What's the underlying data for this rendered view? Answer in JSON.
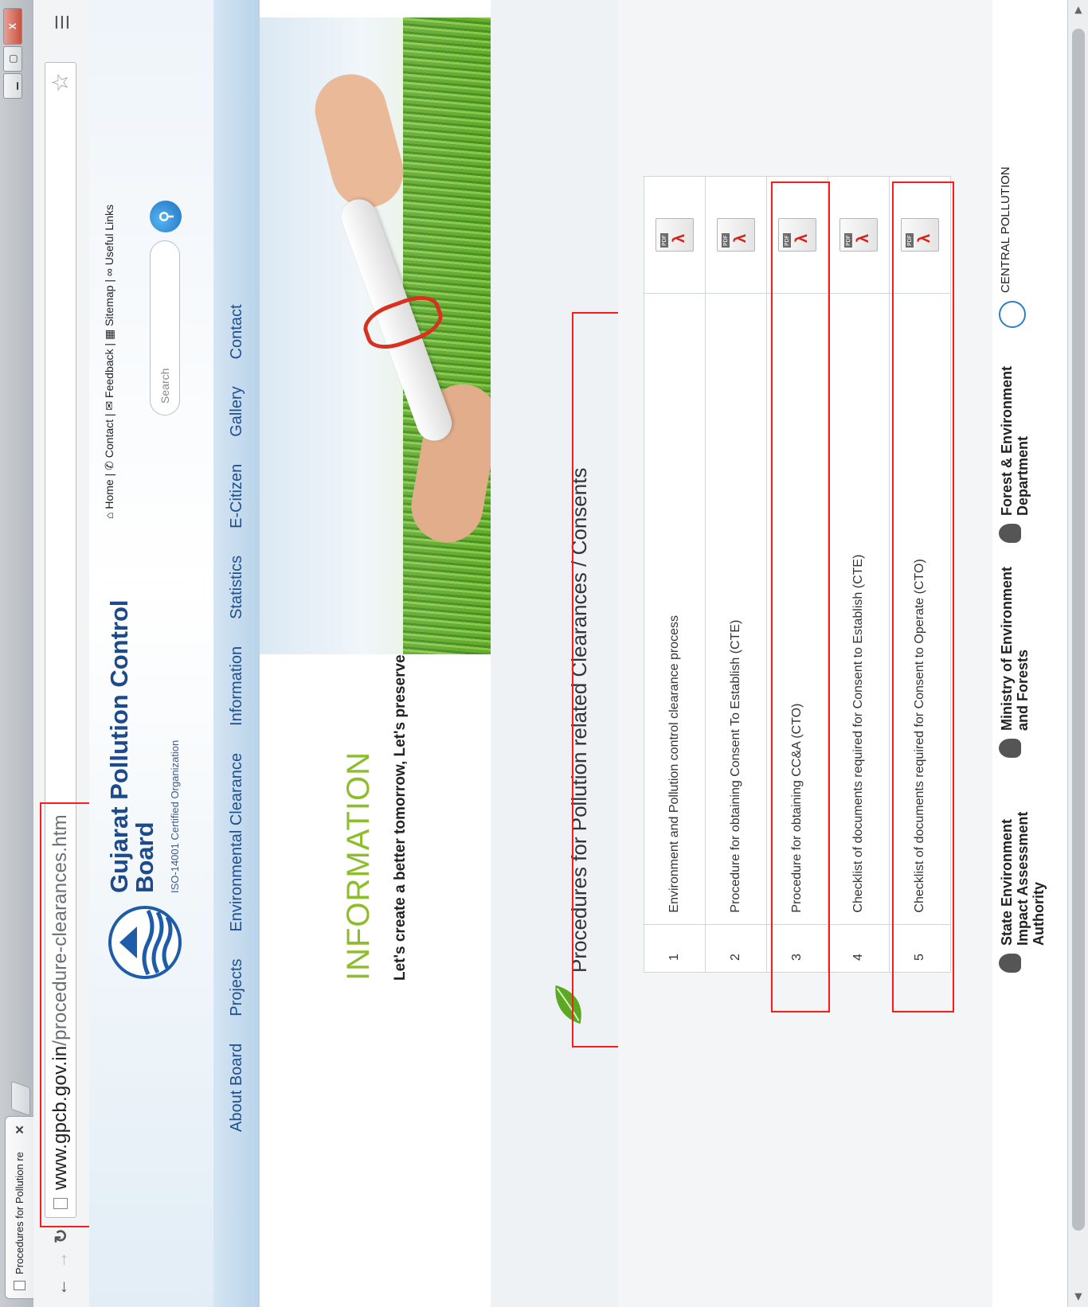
{
  "browser": {
    "tab_title": "Procedures for Pollution re",
    "tab_close": "✕",
    "url_host": "www.gpcb.gov.in",
    "url_path": "/procedure-clearances.htm",
    "win_min": "▁",
    "win_max": "▢",
    "win_close": "X"
  },
  "header": {
    "org_name": "Gujarat Pollution Control Board",
    "org_sub": "ISO-14001 Certified Organization",
    "top_links": [
      "Home",
      "Contact",
      "Feedback",
      "Sitemap",
      "Useful Links"
    ],
    "search_placeholder": "Search"
  },
  "nav": [
    "About Board",
    "Projects",
    "Environmental Clearance",
    "Information",
    "Statistics",
    "E-Citizen",
    "Gallery",
    "Contact"
  ],
  "banner": {
    "heading": "INFORMATION",
    "tagline": "Let's create a better tomorrow, Let's preserve nature-today."
  },
  "section": {
    "title": "Procedures for Pollution related Clearances / Consents"
  },
  "documents": [
    {
      "num": "1",
      "title": "Environment and Pollution control clearance process"
    },
    {
      "num": "2",
      "title": "Procedure for obtaining Consent To Establish (CTE)"
    },
    {
      "num": "3",
      "title": "Procedure for obtaining CC&A (CTO)"
    },
    {
      "num": "4",
      "title": "Checklist of documents required for Consent to Establish (CTE)"
    },
    {
      "num": "5",
      "title": "Checklist of documents required for Consent to Operate (CTO)"
    }
  ],
  "pdf_tag": "PDF",
  "footer": {
    "partners": [
      "State Environment Impact Assessment Authority",
      "Ministry of Environment and Forests",
      "Forest & Environment Department"
    ],
    "cpcb": "CENTRAL POLLUTION"
  },
  "colors": {
    "brand_blue": "#1d4a8a",
    "accent_green": "#8dbd2b",
    "highlight_red": "#ff1a1a"
  }
}
